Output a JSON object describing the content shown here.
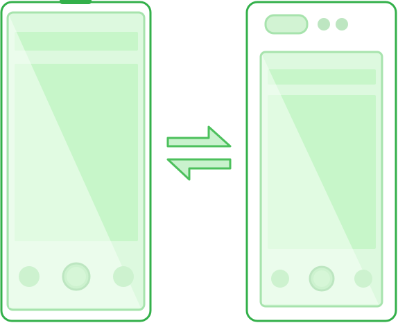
{
  "illustration": {
    "subject": "phone-to-tablet-swap",
    "devices": [
      {
        "kind": "phone",
        "side": "left"
      },
      {
        "kind": "tablet",
        "side": "right"
      }
    ],
    "exchange": {
      "kind": "bidirectional-arrows"
    }
  },
  "colors": {
    "frame_stroke": "#33b04a",
    "frame_fill": "#ffffff",
    "screen_stroke": "#a7e3ad",
    "screen_fill": "#ddf9df",
    "block_fill": "#c7f6c9",
    "light_fill": "#d2f3d3",
    "arrow_stroke": "#4cc05c",
    "arrow_fill": "#c9f2cd",
    "dot_fill": "#bde6c1",
    "shine": "#f5fff5"
  }
}
